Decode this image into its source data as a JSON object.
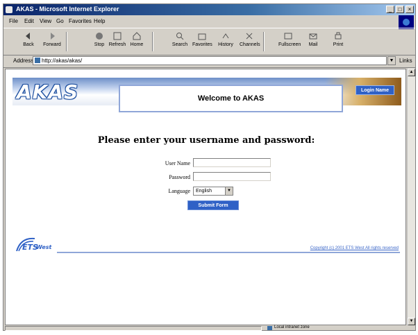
{
  "window": {
    "title": "AKAS - Microsoft Internet Explorer",
    "controls": [
      "_",
      "□",
      "×"
    ]
  },
  "menu": {
    "items": [
      "File",
      "Edit",
      "View",
      "Go",
      "Favorites",
      "Help"
    ]
  },
  "toolbar": {
    "buttons": [
      {
        "label": "Back",
        "icon": "back-arrow-icon"
      },
      {
        "label": "Forward",
        "icon": "forward-arrow-icon"
      },
      {
        "label": "Stop",
        "icon": "stop-icon"
      },
      {
        "label": "Refresh",
        "icon": "refresh-icon"
      },
      {
        "label": "Home",
        "icon": "home-icon"
      },
      {
        "label": "Search",
        "icon": "search-icon"
      },
      {
        "label": "Favorites",
        "icon": "favorites-icon"
      },
      {
        "label": "History",
        "icon": "history-icon"
      },
      {
        "label": "Channels",
        "icon": "channels-icon"
      },
      {
        "label": "Fullscreen",
        "icon": "fullscreen-icon"
      },
      {
        "label": "Mail",
        "icon": "mail-icon"
      },
      {
        "label": "Print",
        "icon": "print-icon"
      }
    ]
  },
  "address": {
    "label": "Address",
    "value": "http://akas/akas/",
    "links_label": "Links"
  },
  "page": {
    "logo_text": "AKAS",
    "welcome": "Welcome to AKAS",
    "login_button": "Login Name",
    "heading": "Please enter your username and password:",
    "form": {
      "username_label": "User Name",
      "username_value": "",
      "password_label": "Password",
      "password_value": "",
      "language_label": "Language",
      "language_value": "English",
      "submit_label": "Submit Form"
    },
    "footer": {
      "logo_text": "ETS",
      "logo_suffix": "West",
      "link_text": "Copyright (c) 2001 ETS West All rights reserved"
    }
  },
  "status": {
    "zone": "Local intranet zone"
  },
  "colors": {
    "title_bar": "#0a246a",
    "chrome": "#d4d0c8",
    "brand_blue": "#2f61c6"
  }
}
